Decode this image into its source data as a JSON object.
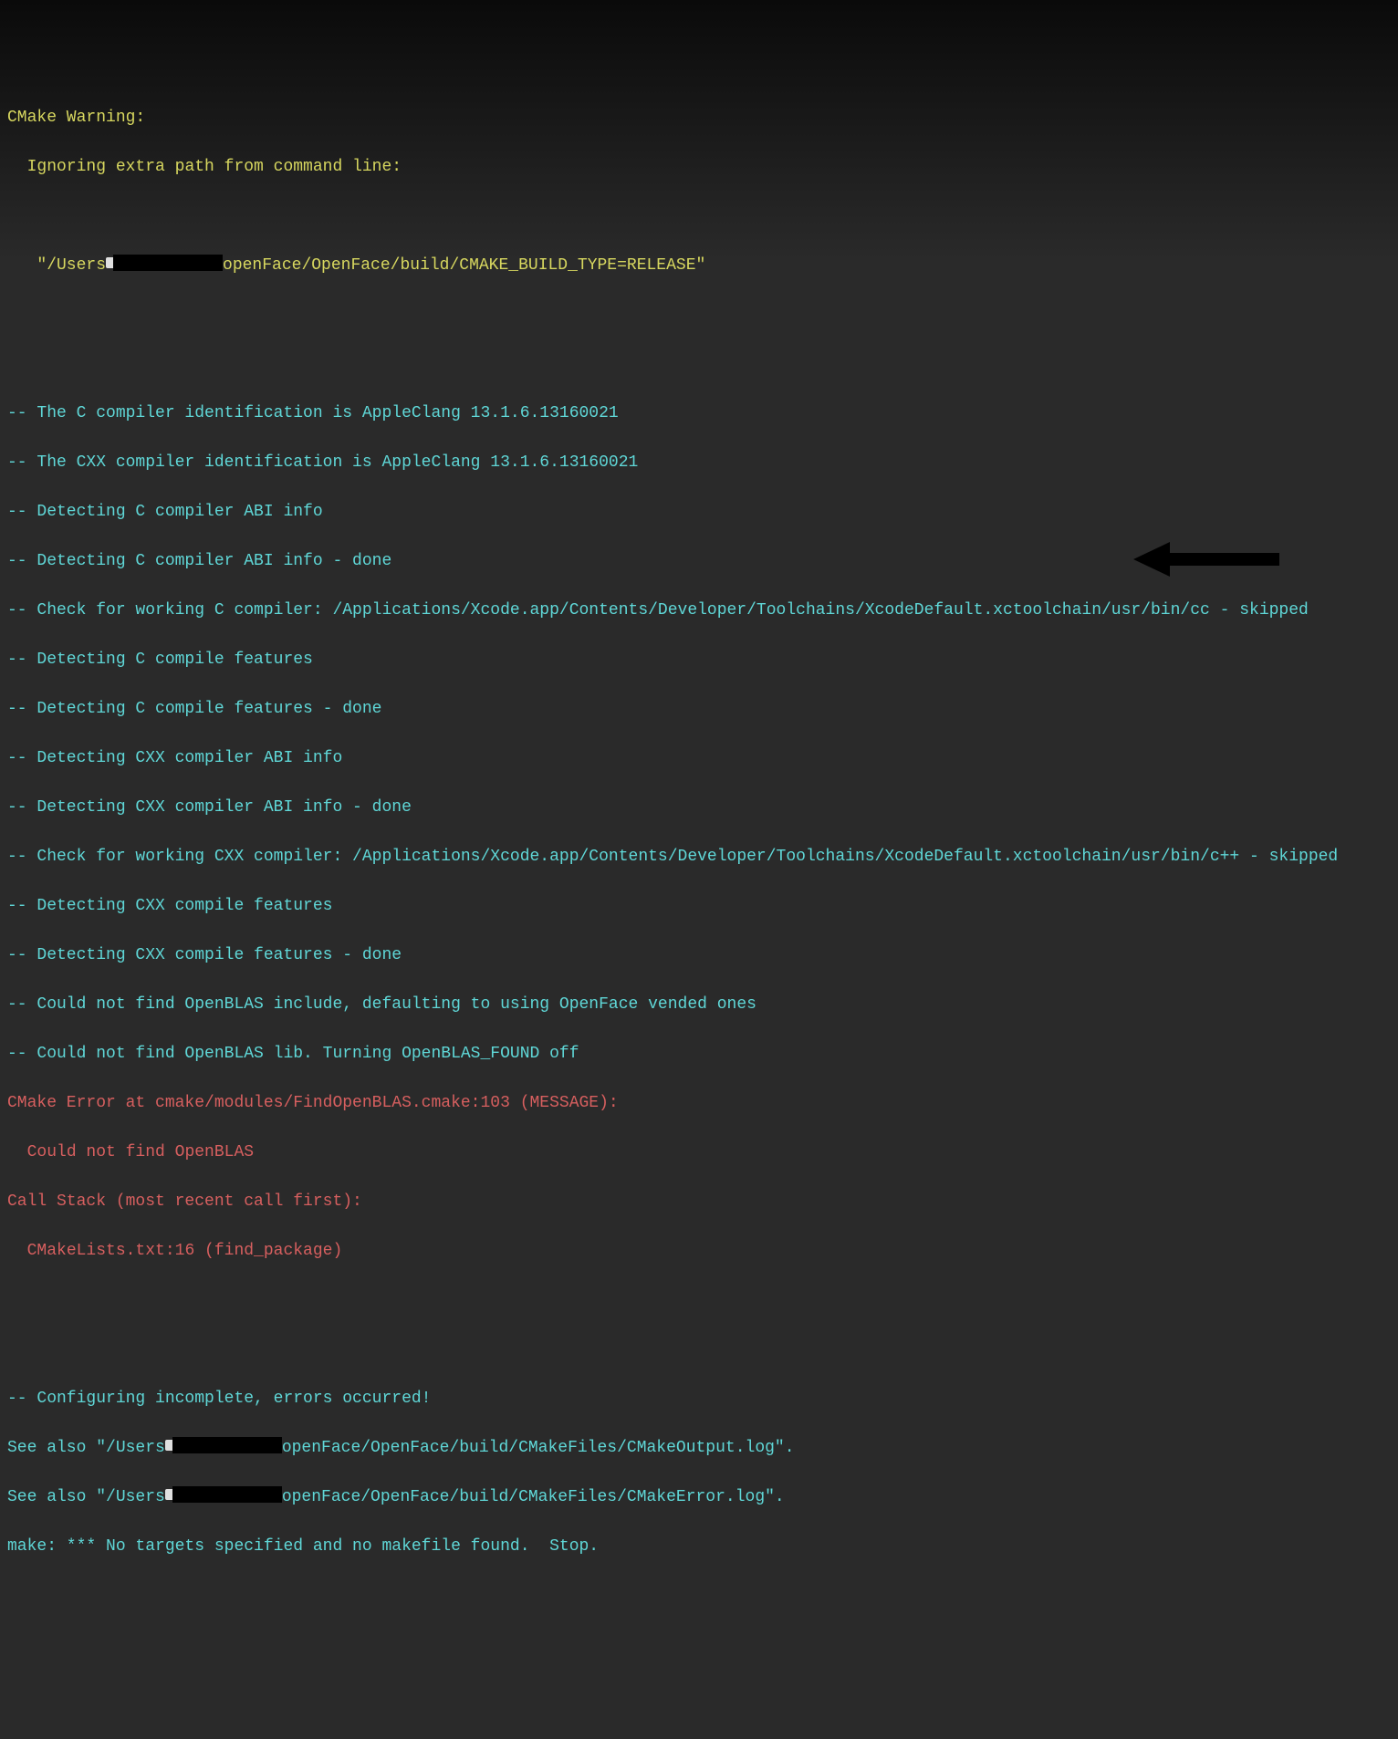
{
  "warning": {
    "line1": "CMake Warning:",
    "line2": "  Ignoring extra path from command line:",
    "line3_pre": "   \"/Users",
    "line3_mid": "openFace/OpenFace/build/CMAKE_BUILD_TYPE=RELEASE\""
  },
  "info": {
    "l1": "-- The C compiler identification is AppleClang 13.1.6.13160021",
    "l2": "-- The CXX compiler identification is AppleClang 13.1.6.13160021",
    "l3": "-- Detecting C compiler ABI info",
    "l4": "-- Detecting C compiler ABI info - done",
    "l5": "-- Check for working C compiler: /Applications/Xcode.app/Contents/Developer/Toolchains/XcodeDefault.xctoolchain/usr/bin/cc - skipped",
    "l6": "-- Detecting C compile features",
    "l7": "-- Detecting C compile features - done",
    "l8": "-- Detecting CXX compiler ABI info",
    "l9": "-- Detecting CXX compiler ABI info - done",
    "l10": "-- Check for working CXX compiler: /Applications/Xcode.app/Contents/Developer/Toolchains/XcodeDefault.xctoolchain/usr/bin/c++ - skipped",
    "l11": "-- Detecting CXX compile features",
    "l12": "-- Detecting CXX compile features - done",
    "l13": "-- Could not find OpenBLAS include, defaulting to using OpenFace vended ones",
    "l14": "-- Could not find OpenBLAS lib. Turning OpenBLAS_FOUND off"
  },
  "error": {
    "l1": "CMake Error at cmake/modules/FindOpenBLAS.cmake:103 (MESSAGE):",
    "l2": "  Could not find OpenBLAS",
    "l3": "Call Stack (most recent call first):",
    "l4": "  CMakeLists.txt:16 (find_package)"
  },
  "footer": {
    "l1": "-- Configuring incomplete, errors occurred!",
    "l2_pre": "See also \"/Users",
    "l2_post": "openFace/OpenFace/build/CMakeFiles/CMakeOutput.log\".",
    "l3_pre": "See also \"/Users",
    "l3_post": "openFace/OpenFace/build/CMakeFiles/CMakeError.log\".",
    "l4": "make: *** No targets specified and no makefile found.  Stop."
  }
}
